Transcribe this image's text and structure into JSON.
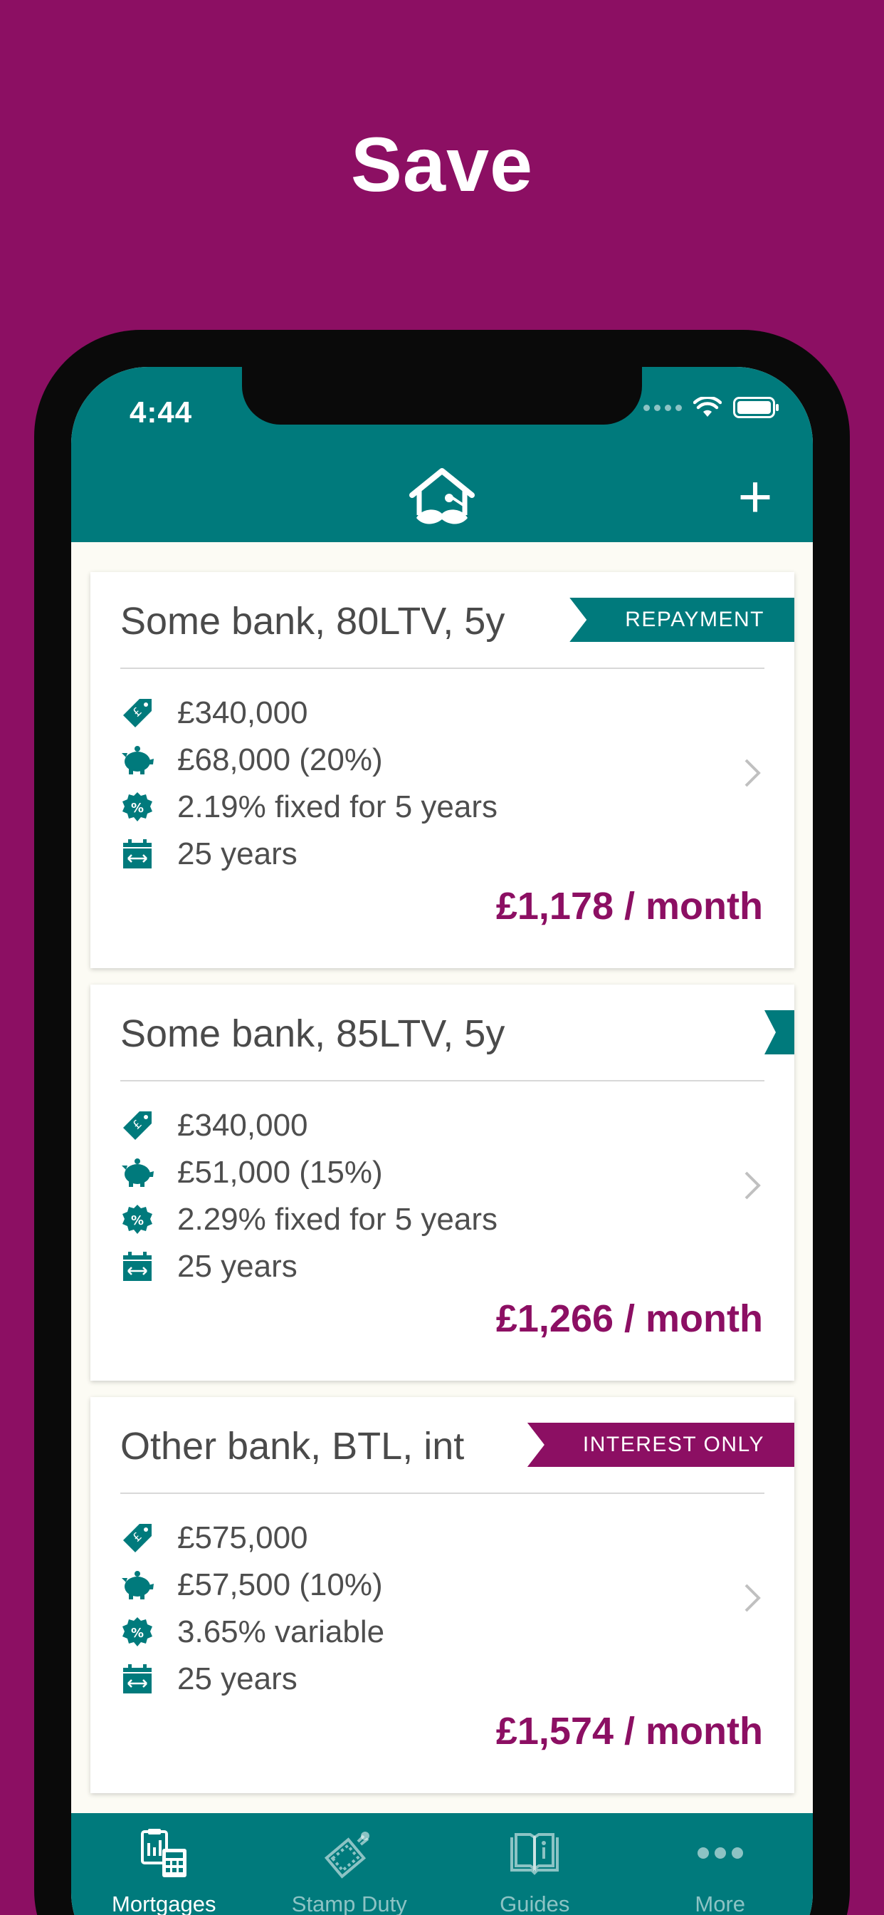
{
  "headline": "Save",
  "status_bar": {
    "time": "4:44"
  },
  "nav": {
    "add_label": "+"
  },
  "cards": [
    {
      "title": "Some bank, 80LTV, 5y",
      "badge": "REPAYMENT",
      "price": "£340,000",
      "deposit": "£68,000 (20%)",
      "rate": "2.19% fixed for 5 years",
      "term": "25 years",
      "monthly": "£1,178 / month"
    },
    {
      "title": "Some bank, 85LTV, 5y",
      "badge": "",
      "price": "£340,000",
      "deposit": "£51,000 (15%)",
      "rate": "2.29% fixed for 5 years",
      "term": "25 years",
      "monthly": "£1,266 / month"
    },
    {
      "title": "Other bank, BTL, int",
      "badge": "INTEREST ONLY",
      "price": "£575,000",
      "deposit": "£57,500 (10%)",
      "rate": "3.65% variable",
      "term": "25 years",
      "monthly": "£1,574 / month"
    }
  ],
  "tabs": [
    {
      "label": "Mortgages",
      "icon": "calculator-icon",
      "active": true
    },
    {
      "label": "Stamp Duty",
      "icon": "stamp-icon",
      "active": false
    },
    {
      "label": "Guides",
      "icon": "book-icon",
      "active": false
    },
    {
      "label": "More",
      "icon": "more-icon",
      "active": false
    }
  ],
  "colors": {
    "brand_purple": "#8c0f63",
    "brand_teal": "#007a7c",
    "card_text": "#4a4a4a"
  }
}
